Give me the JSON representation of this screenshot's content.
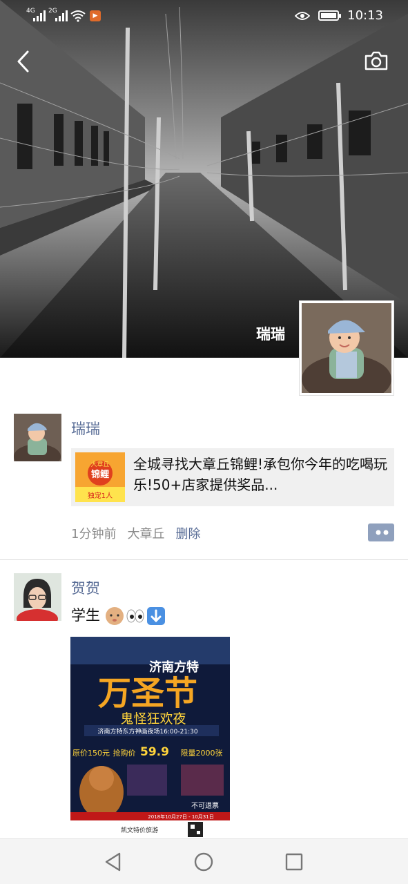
{
  "status_bar": {
    "network_1": "4G",
    "network_2": "2G",
    "app_badge_icon": "video-app-icon",
    "time": "10:13"
  },
  "header": {
    "back_icon": "chevron-left-icon",
    "camera_icon": "camera-icon",
    "owner_name": "瑞瑞"
  },
  "posts": [
    {
      "name": "瑞瑞",
      "link": {
        "thumb_lines": [
          "大章丘",
          "锦鲤",
          "独宠1人"
        ],
        "title": "全城寻找大章丘锦鲤!承包你今年的吃喝玩乐!50+店家提供奖品..."
      },
      "meta": {
        "time": "1分钟前",
        "location": "大章丘",
        "delete": "删除"
      },
      "more_icon": "comment-more-icon"
    },
    {
      "name": "贺贺",
      "text": "学生",
      "emojis": [
        "baby-emoji",
        "eyes-emoji",
        "down-arrow-emoji"
      ],
      "poster": {
        "brand": "济南方特",
        "title_big": "万圣节",
        "subtitle": "鬼怪狂欢夜",
        "venue": "济南方特东方神画夜场16:00-21:30",
        "original_price": "原价150元",
        "sale_label": "抢购价",
        "sale_price": "59.9",
        "limit": "限量2000张",
        "no_refund": "不可退票",
        "footer_note": "凯文特价旅游",
        "date_note": "2018年10月27日 - 10月31日"
      }
    }
  ],
  "navbar": {
    "back": "triangle-back-icon",
    "home": "circle-home-icon",
    "recents": "square-recents-icon"
  },
  "colors": {
    "link_blue": "#576b95",
    "card_bg": "#f0f0f0",
    "poster_orange": "#f5a623",
    "poster_yellow": "#ffd43b"
  }
}
